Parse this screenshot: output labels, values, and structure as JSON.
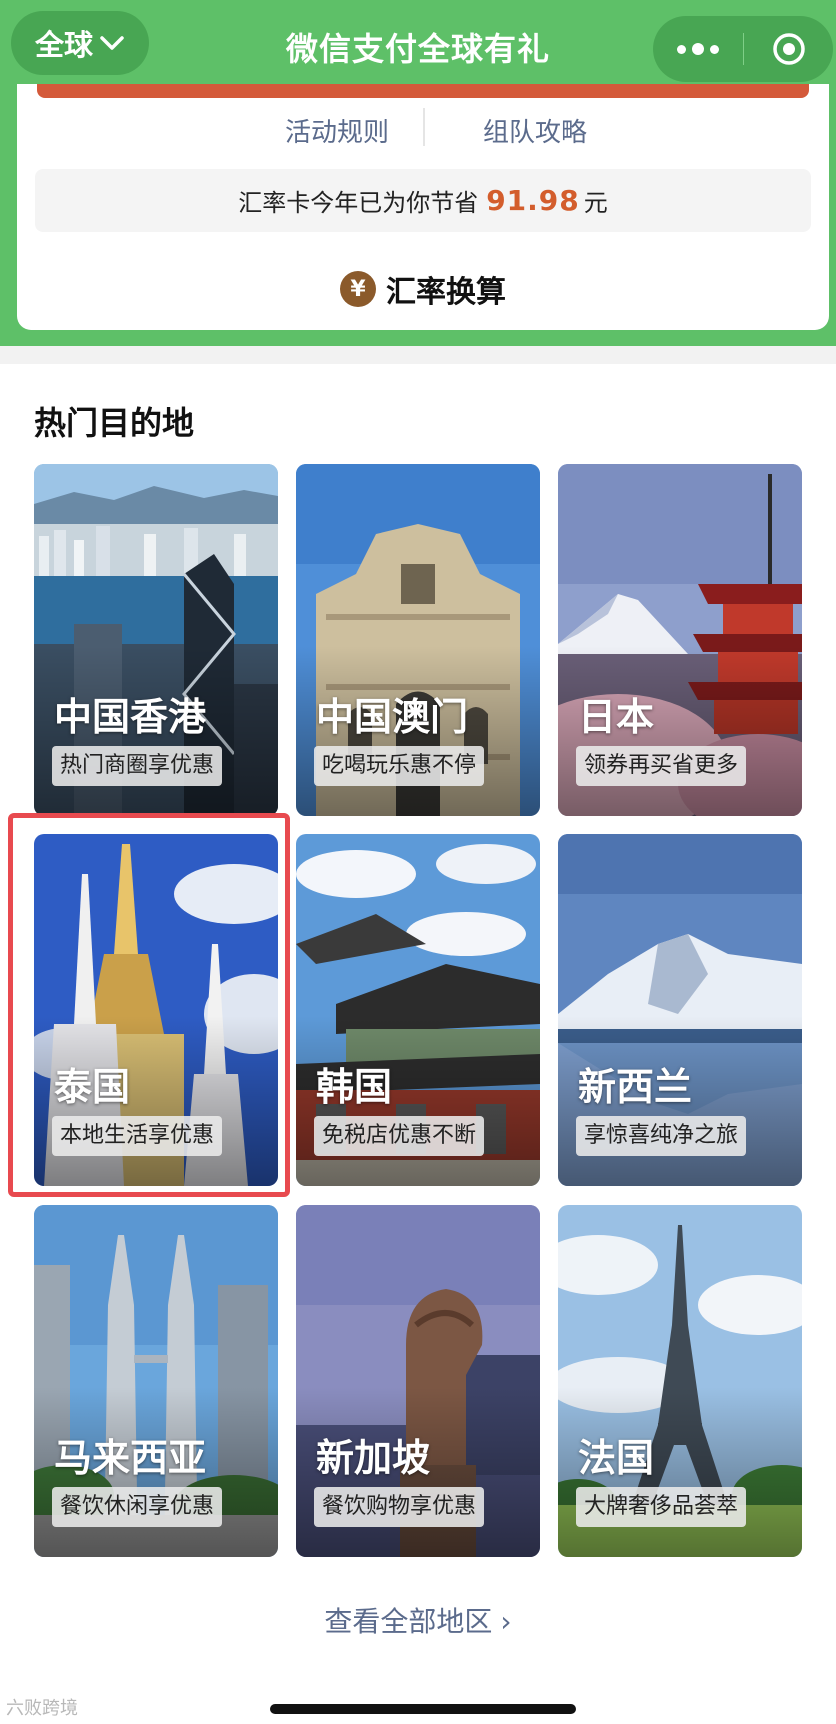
{
  "header": {
    "region_label": "全球",
    "title": "微信支付全球有礼",
    "bg_color": "#5ec068"
  },
  "card": {
    "link_rules": "活动规则",
    "link_team": "组队攻略",
    "saving_prefix": "汇率卡今年已为你节省",
    "saving_amount": "91.98",
    "saving_suffix": "元",
    "calc_icon": "¥",
    "calc_label": "汇率换算",
    "amount_color": "#d35d2c"
  },
  "destinations": {
    "title": "热门目的地",
    "items": [
      {
        "name": "中国香港",
        "tag": "热门商圈享优惠",
        "icon": "hongkong-skyline-photo"
      },
      {
        "name": "中国澳门",
        "tag": "吃喝玩乐惠不停",
        "icon": "macau-ruins-photo"
      },
      {
        "name": "日本",
        "tag": "领券再买省更多",
        "icon": "japan-pagoda-photo"
      },
      {
        "name": "泰国",
        "tag": "本地生活享优惠",
        "icon": "thailand-stupa-photo"
      },
      {
        "name": "韩国",
        "tag": "免税店优惠不断",
        "icon": "korea-palace-photo"
      },
      {
        "name": "新西兰",
        "tag": "享惊喜纯净之旅",
        "icon": "newzealand-mountain-photo"
      },
      {
        "name": "马来西亚",
        "tag": "餐饮休闲享优惠",
        "icon": "malaysia-towers-photo"
      },
      {
        "name": "新加坡",
        "tag": "餐饮购物享优惠",
        "icon": "singapore-merlion-photo"
      },
      {
        "name": "法国",
        "tag": "大牌奢侈品荟萃",
        "icon": "france-eiffel-photo"
      }
    ],
    "view_all": "查看全部地区"
  },
  "watermark": "六败跨境",
  "highlight_color": "#e84a4f"
}
